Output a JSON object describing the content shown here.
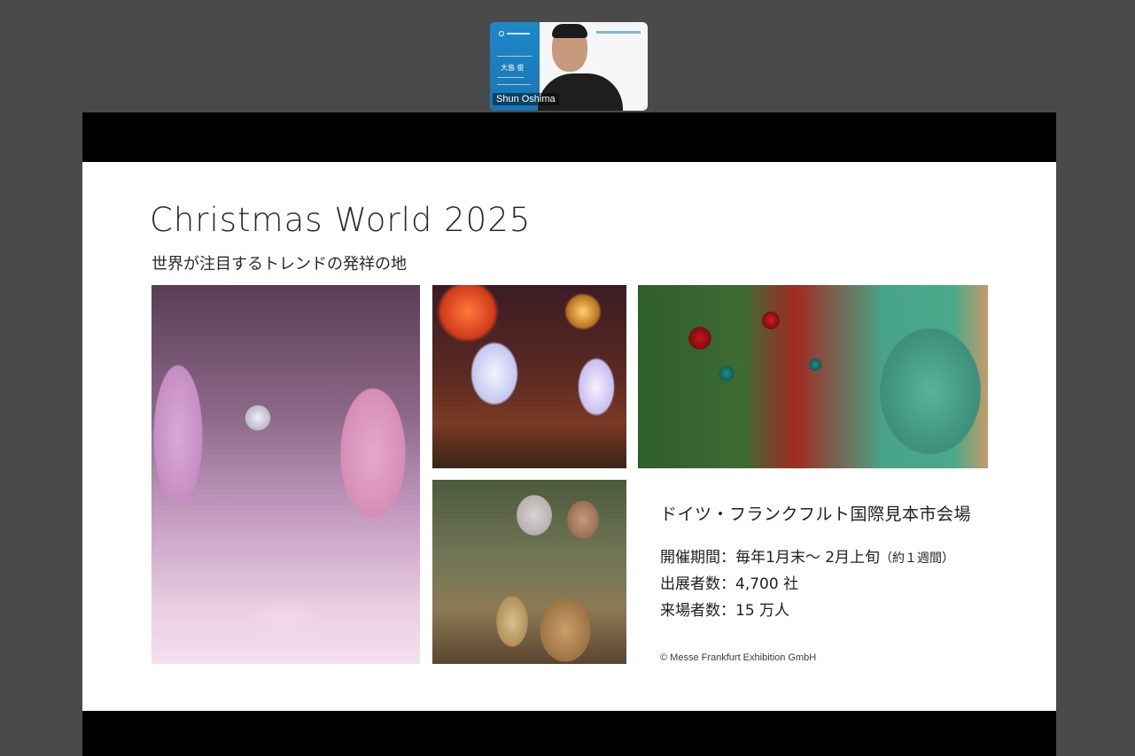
{
  "participant": {
    "name_label": "Shun Oshima",
    "name_jp": "大島 俊"
  },
  "slide": {
    "title": "Christmas World 2025",
    "subtitle": "世界が注目するトレンドの発祥の地",
    "venue": "ドイツ・フランクフルト国際見本市会場",
    "details": [
      {
        "text": "開催期間：毎年1月末～ 2月上旬",
        "note": "（約１週間）"
      },
      {
        "text": "出展者数：4,700 社",
        "note": ""
      },
      {
        "text": "来場者数：15 万人",
        "note": ""
      }
    ],
    "copyright": "© Messe Frankfurt Exhibition GmbH"
  }
}
